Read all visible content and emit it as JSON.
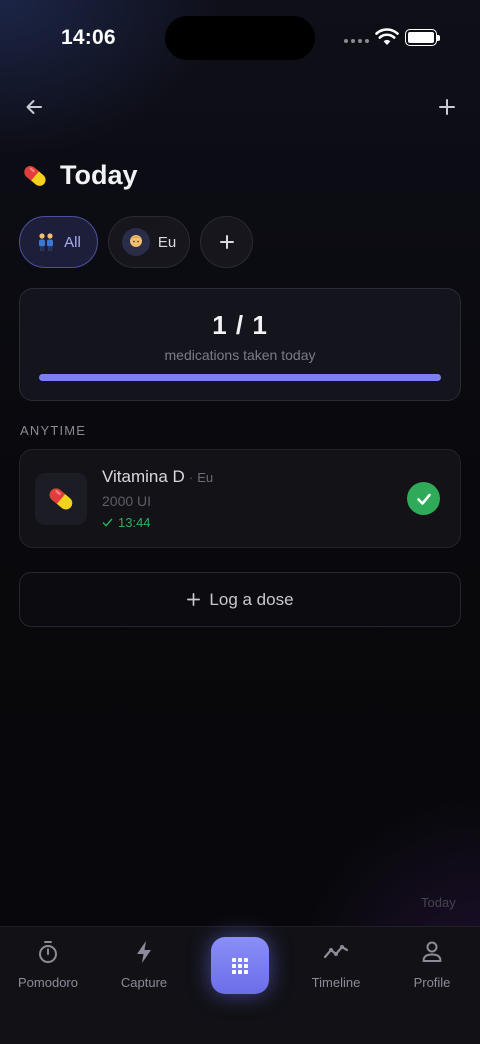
{
  "status": {
    "time": "14:06"
  },
  "header": {
    "title": "Today",
    "title_icon": "pill-emoji"
  },
  "filters": [
    {
      "label": "All",
      "icon": "people-emoji",
      "selected": true
    },
    {
      "label": "Eu",
      "icon": "person-avatar",
      "selected": false
    },
    {
      "label": "",
      "icon": "plus-icon",
      "selected": false
    }
  ],
  "summary": {
    "count": "1 / 1",
    "label": "medications taken today",
    "progress": 1.0
  },
  "section": {
    "label": "ANYTIME"
  },
  "medication": {
    "name": "Vitamina D",
    "separator": "·",
    "person": "Eu",
    "dose": "2000 UI",
    "taken_time": "13:44",
    "status": "taken"
  },
  "log_button": {
    "label": "Log a dose"
  },
  "today_hint": "Today",
  "tabs": [
    {
      "label": "Pomodoro",
      "icon": "timer-icon"
    },
    {
      "label": "Capture",
      "icon": "bolt-icon"
    },
    {
      "label": "",
      "icon": "grid-icon"
    },
    {
      "label": "Timeline",
      "icon": "trend-icon"
    },
    {
      "label": "Profile",
      "icon": "user-icon"
    }
  ],
  "colors": {
    "accent": "#7b7ff0",
    "success": "#2eaa58",
    "background": "#08080c"
  }
}
